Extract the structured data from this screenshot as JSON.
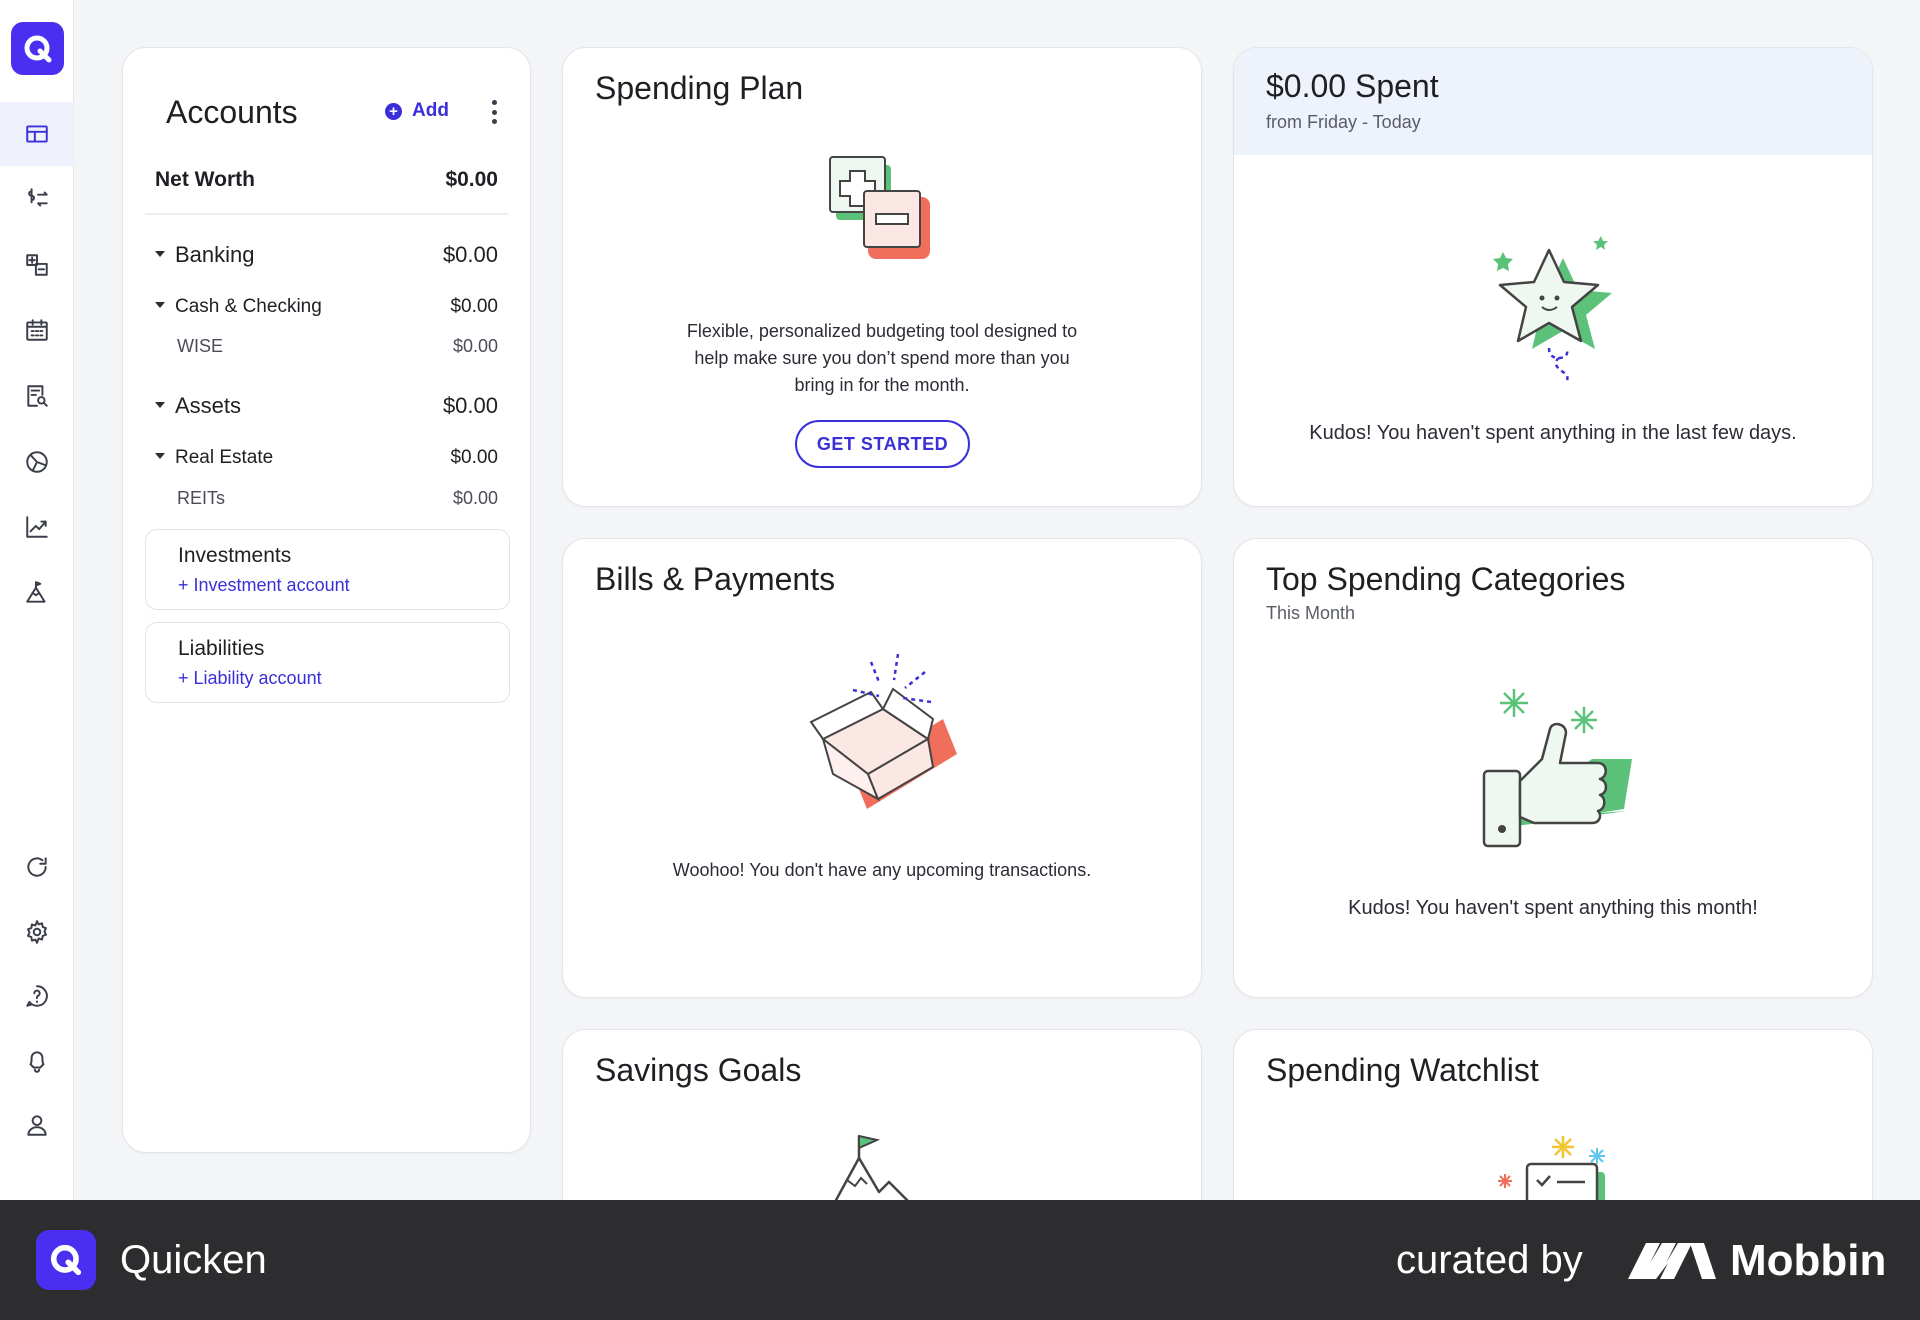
{
  "sidebar": {
    "items": [
      {
        "name": "dashboard",
        "icon": "dashboard-icon",
        "active": true
      },
      {
        "name": "transactions",
        "icon": "transfer-icon"
      },
      {
        "name": "spending-plan",
        "icon": "plan-icon"
      },
      {
        "name": "bills",
        "icon": "calendar-icon"
      },
      {
        "name": "reports",
        "icon": "report-icon"
      },
      {
        "name": "budget",
        "icon": "pie-icon"
      },
      {
        "name": "investments",
        "icon": "trend-icon"
      },
      {
        "name": "goals",
        "icon": "mountain-icon"
      },
      {
        "name": "refresh",
        "icon": "refresh-icon"
      },
      {
        "name": "settings",
        "icon": "gear-icon"
      },
      {
        "name": "help",
        "icon": "help-icon"
      },
      {
        "name": "notifications",
        "icon": "bell-icon"
      },
      {
        "name": "profile",
        "icon": "user-icon"
      }
    ]
  },
  "accounts": {
    "title": "Accounts",
    "add_label": "Add",
    "net_worth_label": "Net Worth",
    "net_worth_value": "$0.00",
    "banking": {
      "label": "Banking",
      "value": "$0.00"
    },
    "cash_checking": {
      "label": "Cash & Checking",
      "value": "$0.00"
    },
    "wise": {
      "label": "WISE",
      "value": "$0.00"
    },
    "assets": {
      "label": "Assets",
      "value": "$0.00"
    },
    "real_estate": {
      "label": "Real Estate",
      "value": "$0.00"
    },
    "reits": {
      "label": "REITs",
      "value": "$0.00"
    },
    "investments": {
      "label": "Investments",
      "link": "+ Investment account"
    },
    "liabilities": {
      "label": "Liabilities",
      "link": "+ Liability account"
    }
  },
  "spending_plan": {
    "title": "Spending Plan",
    "description_lines": [
      "Flexible, personalized budgeting tool designed to",
      "help make sure you don’t spend more than you",
      "bring in for the month."
    ],
    "button": "GET STARTED"
  },
  "spent": {
    "title": "$0.00 Spent",
    "subtitle": "from Friday - Today",
    "message": "Kudos! You haven't spent anything in the last few days."
  },
  "bills": {
    "title": "Bills & Payments",
    "message": "Woohoo! You don't have any upcoming transactions."
  },
  "top_spending": {
    "title": "Top Spending Categories",
    "subtitle": "This Month",
    "message": "Kudos! You haven't spent anything this month!"
  },
  "savings": {
    "title": "Savings Goals"
  },
  "watchlist": {
    "title": "Spending Watchlist"
  },
  "footer": {
    "app_name": "Quicken",
    "curated_by": "curated by",
    "brand": "Mobbin"
  },
  "colors": {
    "accent": "#3a2fd8",
    "brand": "#4a2ff0",
    "green": "#5cc27a",
    "coral": "#ef6f5c"
  }
}
